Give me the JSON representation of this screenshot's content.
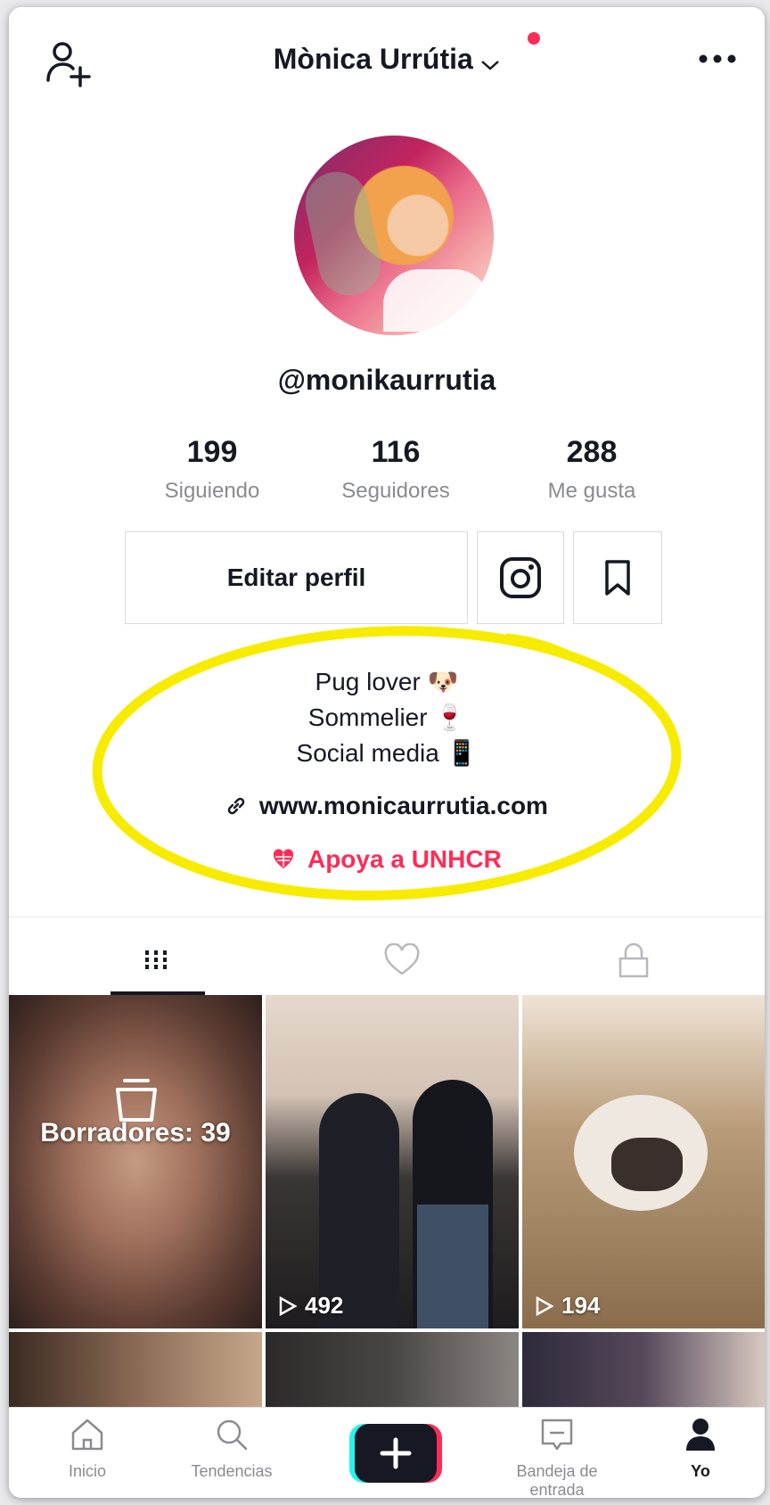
{
  "header": {
    "title": "Mònica Urrútia",
    "add_user_icon": "add-user-icon",
    "more_icon": "more-horizontal-icon",
    "notification_color": "#fe2c55"
  },
  "profile": {
    "handle": "@monikaurrutia",
    "stats": [
      {
        "value": "199",
        "label": "Siguiendo"
      },
      {
        "value": "116",
        "label": "Seguidores"
      },
      {
        "value": "288",
        "label": "Me gusta"
      }
    ]
  },
  "actions": {
    "edit_label": "Editar perfil",
    "instagram_icon": "instagram-icon",
    "bookmark_icon": "bookmark-icon"
  },
  "bio": {
    "line1": "Pug lover",
    "line1_emoji": "🐶",
    "line2": "Sommelier",
    "line2_emoji": "🍷",
    "line3": "Social media",
    "line3_emoji": "📱",
    "link": "www.monicaurrutia.com",
    "cause": "Apoya a UNHCR",
    "highlight_color": "#f7ec00",
    "accent_color": "#fe2c55"
  },
  "tabs": [
    {
      "icon": "grid-icon",
      "active": true
    },
    {
      "icon": "heart-icon",
      "active": false
    },
    {
      "icon": "lock-icon",
      "active": false
    }
  ],
  "grid": {
    "drafts_label": "Borradores: 39",
    "video_views": [
      "492",
      "194"
    ]
  },
  "nav": {
    "items": [
      {
        "label": "Inicio",
        "icon": "home-icon"
      },
      {
        "label": "Tendencias",
        "icon": "search-icon"
      },
      {
        "label": "",
        "icon": "create-plus-icon"
      },
      {
        "label": "Bandeja de entrada",
        "icon": "inbox-icon"
      },
      {
        "label": "Yo",
        "icon": "profile-icon"
      }
    ]
  }
}
